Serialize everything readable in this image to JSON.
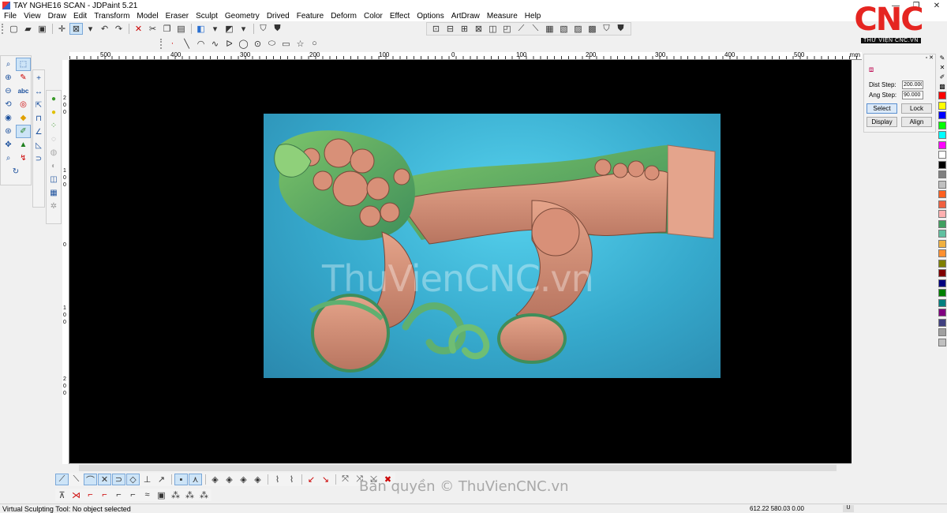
{
  "window": {
    "title": "TAY NGHE16 SCAN - JDPaint 5.21",
    "minimize": "—",
    "maximize": "❐",
    "close": "✕"
  },
  "menu": [
    "File",
    "View",
    "Draw",
    "Edit",
    "Transform",
    "Model",
    "Eraser",
    "Sculpt",
    "Geometry",
    "Drived",
    "Feature",
    "Deform",
    "Color",
    "Effect",
    "Options",
    "ArtDraw",
    "Measure",
    "Help"
  ],
  "logo": {
    "text": "CNC",
    "subtitle": "THƯ VIỆN CNC.VN",
    "accent": "#e52521"
  },
  "ruler": {
    "unit": "mm",
    "top_labels": [
      "500",
      "400",
      "300",
      "200",
      "100",
      "0",
      "100",
      "200",
      "300",
      "400",
      "500"
    ],
    "left_labels": [
      "200",
      "100",
      "0",
      "100",
      "200"
    ]
  },
  "canvas": {
    "watermark": "ThuVienCNC.vn",
    "background": "#000000",
    "relief_color": "#3fb7d8"
  },
  "right_panel": {
    "dist_step_label": "Dist Step:",
    "dist_step_value": "200.000",
    "ang_step_label": "Ang Step:",
    "ang_step_value": "90.000",
    "select_label": "Select",
    "lock_label": "Lock",
    "display_label": "Display",
    "align_label": "Align"
  },
  "colors": [
    "#ff0000",
    "#ffff00",
    "#0000ff",
    "#00ff00",
    "#00ffff",
    "#ff00ff",
    "#ffffff",
    "#000000",
    "#808080",
    "#c0c0c0",
    "#ff6020",
    "#f06040",
    "#ffb0b0",
    "#40a060",
    "#60c0a0",
    "#f0b040",
    "#ff9030",
    "#808000",
    "#800000",
    "#000080",
    "#008000",
    "#008080",
    "#800080",
    "#404080",
    "#a0a0a0",
    "#c0c0c0"
  ],
  "copyright": "Bản quyền © ThuVienCNC.vn",
  "status": {
    "message": "Virtual Sculpting Tool: No object selected",
    "coords": "612.22 580.03 0.00",
    "unit": "U"
  }
}
